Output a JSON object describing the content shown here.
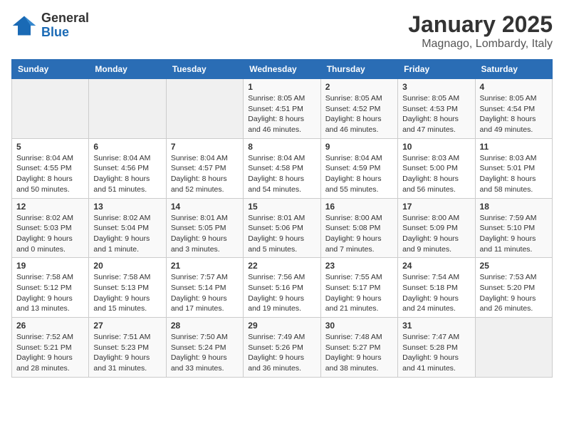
{
  "logo": {
    "general": "General",
    "blue": "Blue"
  },
  "header": {
    "title": "January 2025",
    "subtitle": "Magnago, Lombardy, Italy"
  },
  "weekdays": [
    "Sunday",
    "Monday",
    "Tuesday",
    "Wednesday",
    "Thursday",
    "Friday",
    "Saturday"
  ],
  "weeks": [
    [
      {
        "day": "",
        "info": ""
      },
      {
        "day": "",
        "info": ""
      },
      {
        "day": "",
        "info": ""
      },
      {
        "day": "1",
        "info": "Sunrise: 8:05 AM\nSunset: 4:51 PM\nDaylight: 8 hours and 46 minutes."
      },
      {
        "day": "2",
        "info": "Sunrise: 8:05 AM\nSunset: 4:52 PM\nDaylight: 8 hours and 46 minutes."
      },
      {
        "day": "3",
        "info": "Sunrise: 8:05 AM\nSunset: 4:53 PM\nDaylight: 8 hours and 47 minutes."
      },
      {
        "day": "4",
        "info": "Sunrise: 8:05 AM\nSunset: 4:54 PM\nDaylight: 8 hours and 49 minutes."
      }
    ],
    [
      {
        "day": "5",
        "info": "Sunrise: 8:04 AM\nSunset: 4:55 PM\nDaylight: 8 hours and 50 minutes."
      },
      {
        "day": "6",
        "info": "Sunrise: 8:04 AM\nSunset: 4:56 PM\nDaylight: 8 hours and 51 minutes."
      },
      {
        "day": "7",
        "info": "Sunrise: 8:04 AM\nSunset: 4:57 PM\nDaylight: 8 hours and 52 minutes."
      },
      {
        "day": "8",
        "info": "Sunrise: 8:04 AM\nSunset: 4:58 PM\nDaylight: 8 hours and 54 minutes."
      },
      {
        "day": "9",
        "info": "Sunrise: 8:04 AM\nSunset: 4:59 PM\nDaylight: 8 hours and 55 minutes."
      },
      {
        "day": "10",
        "info": "Sunrise: 8:03 AM\nSunset: 5:00 PM\nDaylight: 8 hours and 56 minutes."
      },
      {
        "day": "11",
        "info": "Sunrise: 8:03 AM\nSunset: 5:01 PM\nDaylight: 8 hours and 58 minutes."
      }
    ],
    [
      {
        "day": "12",
        "info": "Sunrise: 8:02 AM\nSunset: 5:03 PM\nDaylight: 9 hours and 0 minutes."
      },
      {
        "day": "13",
        "info": "Sunrise: 8:02 AM\nSunset: 5:04 PM\nDaylight: 9 hours and 1 minute."
      },
      {
        "day": "14",
        "info": "Sunrise: 8:01 AM\nSunset: 5:05 PM\nDaylight: 9 hours and 3 minutes."
      },
      {
        "day": "15",
        "info": "Sunrise: 8:01 AM\nSunset: 5:06 PM\nDaylight: 9 hours and 5 minutes."
      },
      {
        "day": "16",
        "info": "Sunrise: 8:00 AM\nSunset: 5:08 PM\nDaylight: 9 hours and 7 minutes."
      },
      {
        "day": "17",
        "info": "Sunrise: 8:00 AM\nSunset: 5:09 PM\nDaylight: 9 hours and 9 minutes."
      },
      {
        "day": "18",
        "info": "Sunrise: 7:59 AM\nSunset: 5:10 PM\nDaylight: 9 hours and 11 minutes."
      }
    ],
    [
      {
        "day": "19",
        "info": "Sunrise: 7:58 AM\nSunset: 5:12 PM\nDaylight: 9 hours and 13 minutes."
      },
      {
        "day": "20",
        "info": "Sunrise: 7:58 AM\nSunset: 5:13 PM\nDaylight: 9 hours and 15 minutes."
      },
      {
        "day": "21",
        "info": "Sunrise: 7:57 AM\nSunset: 5:14 PM\nDaylight: 9 hours and 17 minutes."
      },
      {
        "day": "22",
        "info": "Sunrise: 7:56 AM\nSunset: 5:16 PM\nDaylight: 9 hours and 19 minutes."
      },
      {
        "day": "23",
        "info": "Sunrise: 7:55 AM\nSunset: 5:17 PM\nDaylight: 9 hours and 21 minutes."
      },
      {
        "day": "24",
        "info": "Sunrise: 7:54 AM\nSunset: 5:18 PM\nDaylight: 9 hours and 24 minutes."
      },
      {
        "day": "25",
        "info": "Sunrise: 7:53 AM\nSunset: 5:20 PM\nDaylight: 9 hours and 26 minutes."
      }
    ],
    [
      {
        "day": "26",
        "info": "Sunrise: 7:52 AM\nSunset: 5:21 PM\nDaylight: 9 hours and 28 minutes."
      },
      {
        "day": "27",
        "info": "Sunrise: 7:51 AM\nSunset: 5:23 PM\nDaylight: 9 hours and 31 minutes."
      },
      {
        "day": "28",
        "info": "Sunrise: 7:50 AM\nSunset: 5:24 PM\nDaylight: 9 hours and 33 minutes."
      },
      {
        "day": "29",
        "info": "Sunrise: 7:49 AM\nSunset: 5:26 PM\nDaylight: 9 hours and 36 minutes."
      },
      {
        "day": "30",
        "info": "Sunrise: 7:48 AM\nSunset: 5:27 PM\nDaylight: 9 hours and 38 minutes."
      },
      {
        "day": "31",
        "info": "Sunrise: 7:47 AM\nSunset: 5:28 PM\nDaylight: 9 hours and 41 minutes."
      },
      {
        "day": "",
        "info": ""
      }
    ]
  ]
}
